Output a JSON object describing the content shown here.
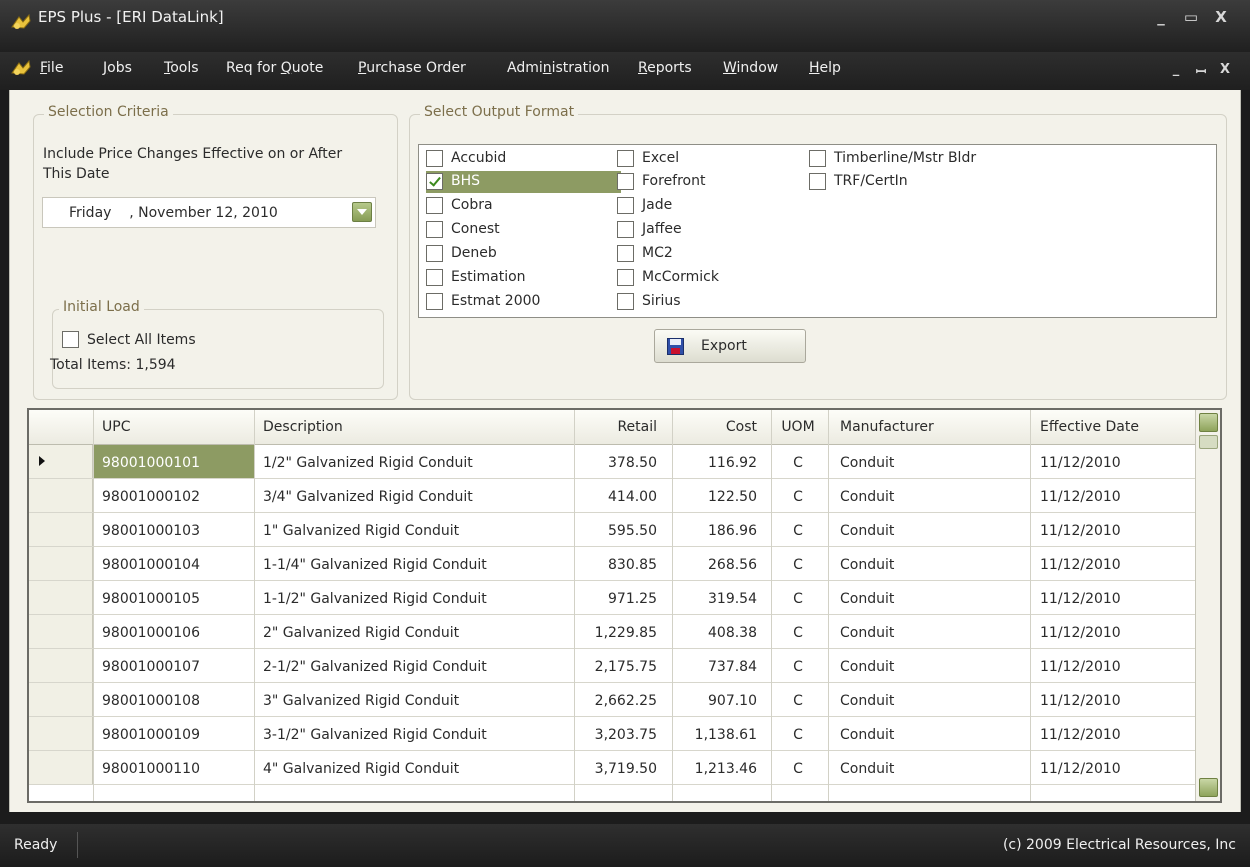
{
  "window": {
    "title": "EPS Plus - [ERI DataLink]",
    "controls": {
      "minimize": "_",
      "maximize": "▭",
      "close": "X"
    },
    "mdi_controls": {
      "minimize": "_",
      "restore": "ꟷ",
      "close": "X"
    }
  },
  "menu": [
    {
      "label": "File",
      "key": "F",
      "rest": "ile"
    },
    {
      "label": "Jobs",
      "key": "J",
      "rest": "obs"
    },
    {
      "label": "Tools",
      "key": "T",
      "rest": "ools"
    },
    {
      "label": "Req for Quote",
      "pre": "Req for ",
      "key": "Q",
      "rest": "uote"
    },
    {
      "label": "Purchase Order",
      "key": "P",
      "rest": "urchase Order"
    },
    {
      "label": "Administration",
      "pre": "Admi",
      "key": "n",
      "rest": "istration"
    },
    {
      "label": "Reports",
      "key": "R",
      "rest": "eports"
    },
    {
      "label": "Window",
      "key": "W",
      "rest": "indow"
    },
    {
      "label": "Help",
      "key": "H",
      "rest": "elp"
    }
  ],
  "selection": {
    "group_title": "Selection Criteria",
    "include_label_1": "Include Price Changes Effective on or After",
    "include_label_2": "This Date",
    "date_value": "Friday    , November 12, 2010"
  },
  "initial_load": {
    "group_title": "Initial Load",
    "select_all_label": "Select All Items",
    "total_items": "Total Items: 1,594"
  },
  "output": {
    "group_title": "Select Output Format",
    "columns": [
      [
        {
          "label": "Accubid",
          "checked": false
        },
        {
          "label": "BHS",
          "checked": true,
          "selected": true
        },
        {
          "label": "Cobra",
          "checked": false
        },
        {
          "label": "Conest",
          "checked": false
        },
        {
          "label": "Deneb",
          "checked": false
        },
        {
          "label": "Estimation",
          "checked": false
        },
        {
          "label": "Estmat 2000",
          "checked": false
        }
      ],
      [
        {
          "label": "Excel",
          "checked": false
        },
        {
          "label": "Forefront",
          "checked": false
        },
        {
          "label": "Jade",
          "checked": false
        },
        {
          "label": "Jaffee",
          "checked": false
        },
        {
          "label": "MC2",
          "checked": false
        },
        {
          "label": "McCormick",
          "checked": false
        },
        {
          "label": "Sirius",
          "checked": false
        }
      ],
      [
        {
          "label": "Timberline/Mstr Bldr",
          "checked": false
        },
        {
          "label": "TRF/CertIn",
          "checked": false
        }
      ]
    ],
    "export_label": "Export"
  },
  "grid": {
    "headers": [
      "UPC",
      "Description",
      "Retail",
      "Cost",
      "UOM",
      "Manufacturer",
      "Effective Date"
    ],
    "rows": [
      [
        "98001000101",
        "1/2\" Galvanized Rigid Conduit",
        "378.50",
        "116.92",
        "C",
        "Conduit",
        "11/12/2010"
      ],
      [
        "98001000102",
        "3/4\" Galvanized Rigid Conduit",
        "414.00",
        "122.50",
        "C",
        "Conduit",
        "11/12/2010"
      ],
      [
        "98001000103",
        "1\" Galvanized Rigid Conduit",
        "595.50",
        "186.96",
        "C",
        "Conduit",
        "11/12/2010"
      ],
      [
        "98001000104",
        "1-1/4\" Galvanized Rigid Conduit",
        "830.85",
        "268.56",
        "C",
        "Conduit",
        "11/12/2010"
      ],
      [
        "98001000105",
        "1-1/2\" Galvanized Rigid Conduit",
        "971.25",
        "319.54",
        "C",
        "Conduit",
        "11/12/2010"
      ],
      [
        "98001000106",
        "2\" Galvanized Rigid Conduit",
        "1,229.85",
        "408.38",
        "C",
        "Conduit",
        "11/12/2010"
      ],
      [
        "98001000107",
        "2-1/2\" Galvanized Rigid Conduit",
        "2,175.75",
        "737.84",
        "C",
        "Conduit",
        "11/12/2010"
      ],
      [
        "98001000108",
        "3\" Galvanized Rigid Conduit",
        "2,662.25",
        "907.10",
        "C",
        "Conduit",
        "11/12/2010"
      ],
      [
        "98001000109",
        "3-1/2\" Galvanized Rigid Conduit",
        "3,203.75",
        "1,138.61",
        "C",
        "Conduit",
        "11/12/2010"
      ],
      [
        "98001000110",
        "4\" Galvanized Rigid Conduit",
        "3,719.50",
        "1,213.46",
        "C",
        "Conduit",
        "11/12/2010"
      ]
    ]
  },
  "status": {
    "left": "Ready",
    "right": "(c) 2009 Electrical Resources, Inc"
  }
}
